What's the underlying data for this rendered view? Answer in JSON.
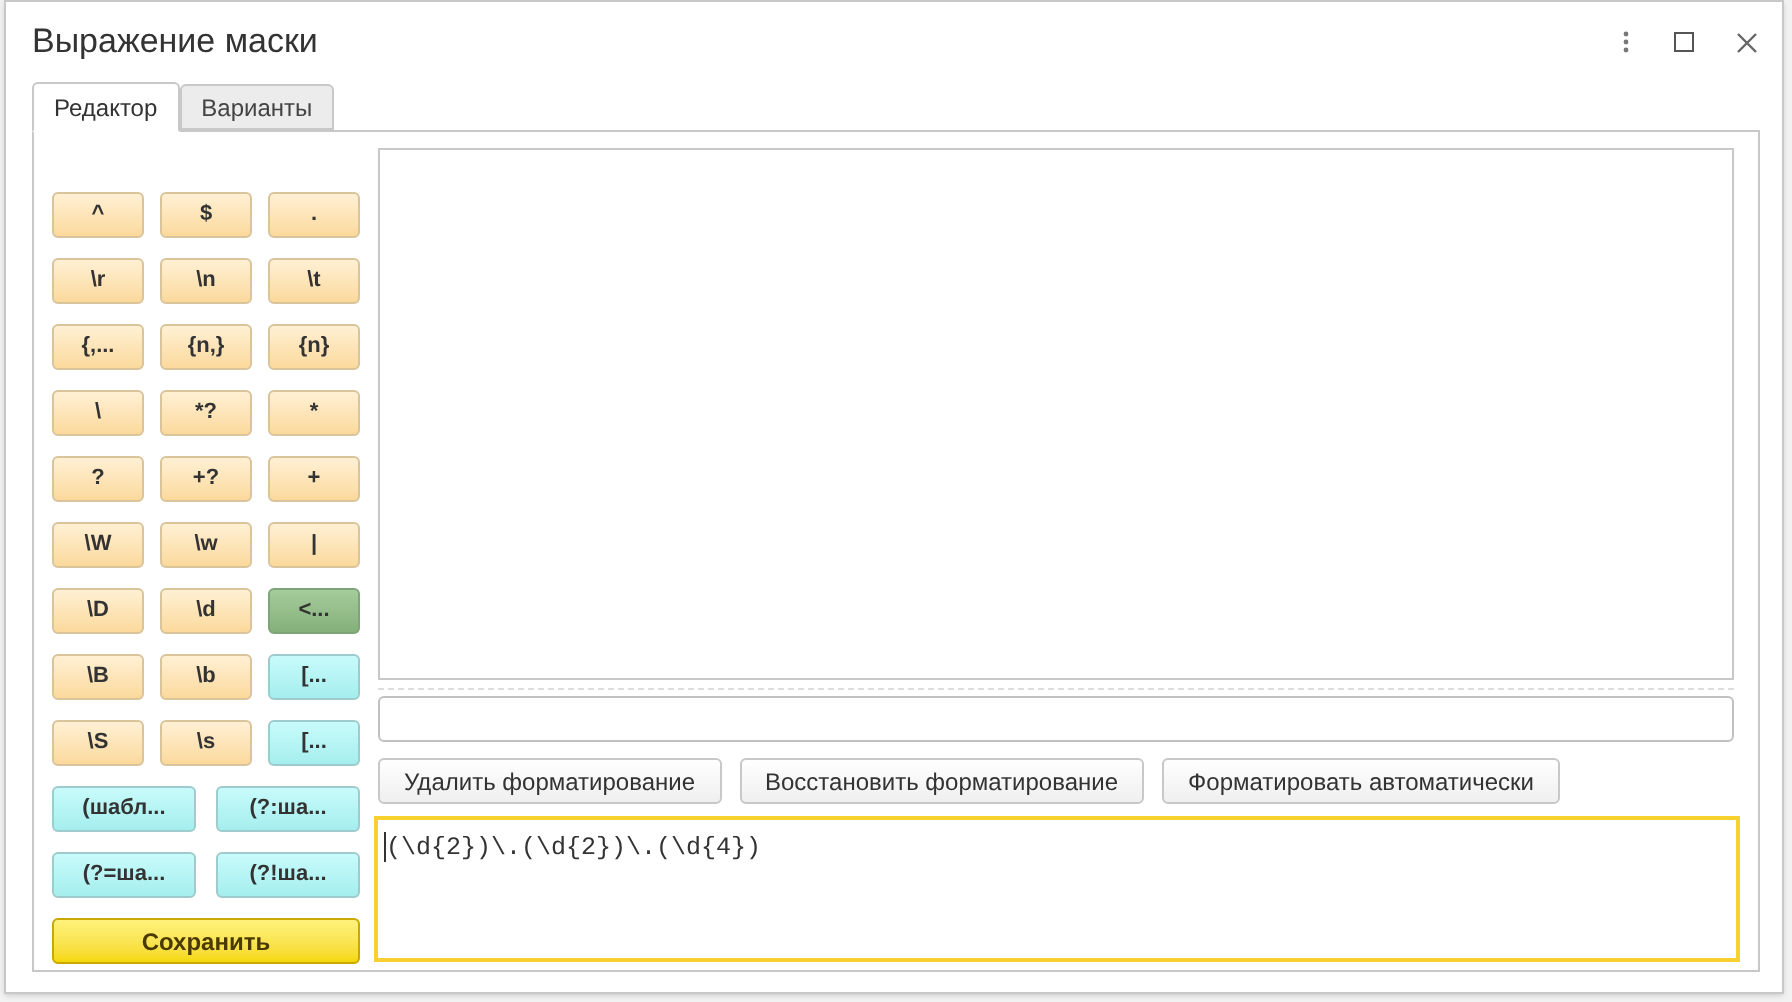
{
  "window": {
    "title": "Выражение маски"
  },
  "tabs": [
    {
      "label": "Редактор",
      "selected": true
    },
    {
      "label": "Варианты",
      "selected": false
    }
  ],
  "palette": [
    {
      "label": "^",
      "kind": "plain"
    },
    {
      "label": "$",
      "kind": "plain"
    },
    {
      "label": ".",
      "kind": "plain"
    },
    {
      "label": "\\r",
      "kind": "plain"
    },
    {
      "label": "\\n",
      "kind": "plain"
    },
    {
      "label": "\\t",
      "kind": "plain"
    },
    {
      "label": "{,...",
      "kind": "plain"
    },
    {
      "label": "{n,}",
      "kind": "plain"
    },
    {
      "label": "{n}",
      "kind": "plain"
    },
    {
      "label": "\\",
      "kind": "plain"
    },
    {
      "label": "*?",
      "kind": "plain"
    },
    {
      "label": "*",
      "kind": "plain"
    },
    {
      "label": "?",
      "kind": "plain"
    },
    {
      "label": "+?",
      "kind": "plain"
    },
    {
      "label": "+",
      "kind": "plain"
    },
    {
      "label": "\\W",
      "kind": "plain"
    },
    {
      "label": "\\w",
      "kind": "plain"
    },
    {
      "label": "|",
      "kind": "plain"
    },
    {
      "label": "\\D",
      "kind": "plain"
    },
    {
      "label": "\\d",
      "kind": "plain"
    },
    {
      "label": "<...",
      "kind": "green"
    },
    {
      "label": "\\B",
      "kind": "plain"
    },
    {
      "label": "\\b",
      "kind": "plain"
    },
    {
      "label": "[...",
      "kind": "cyan"
    },
    {
      "label": "\\S",
      "kind": "plain"
    },
    {
      "label": "\\s",
      "kind": "plain"
    },
    {
      "label": "[...",
      "kind": "cyan"
    }
  ],
  "group_buttons": [
    {
      "label": "(шабл...",
      "kind": "cyan"
    },
    {
      "label": "(?:ша...",
      "kind": "cyan"
    },
    {
      "label": "(?=ша...",
      "kind": "cyan"
    },
    {
      "label": "(?!ша...",
      "kind": "cyan"
    }
  ],
  "save_button": "Сохранить",
  "format_buttons": [
    "Удалить форматирование",
    "Восстановить форматирование",
    "Форматировать автоматически"
  ],
  "expression": "(\\d{2})\\.(\\d{2})\\.(\\d{4})"
}
